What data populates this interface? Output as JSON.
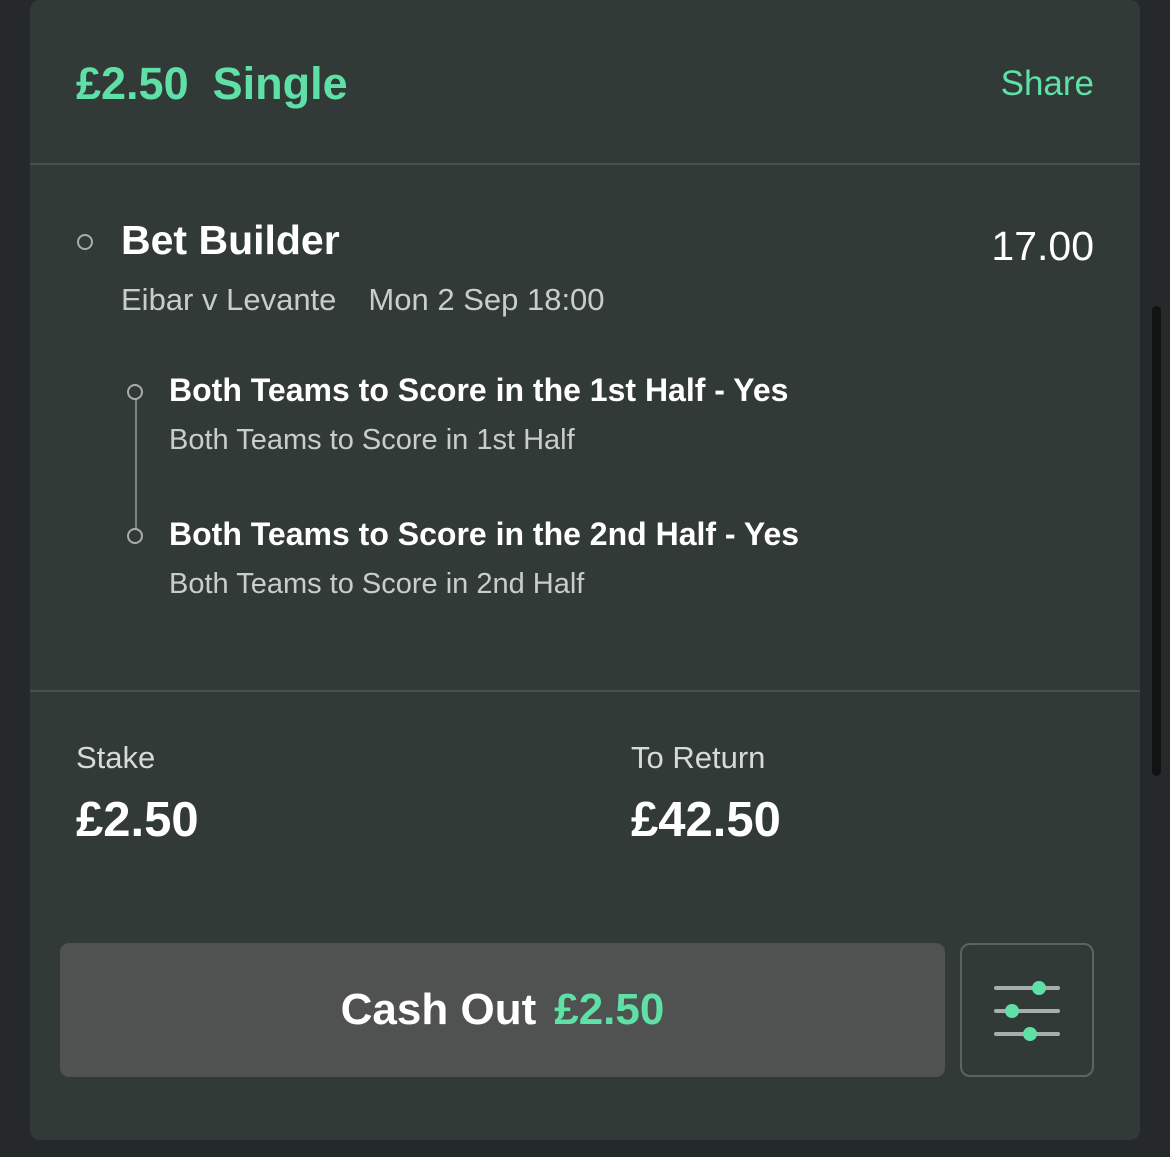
{
  "header": {
    "stake": "£2.50",
    "bet_type": "Single",
    "share_label": "Share"
  },
  "bet": {
    "name": "Bet Builder",
    "odds": "17.00",
    "event": "Eibar v Levante",
    "datetime": "Mon 2 Sep 18:00",
    "selections": [
      {
        "title": "Both Teams to Score in the 1st Half - Yes",
        "market": "Both Teams to Score in 1st Half"
      },
      {
        "title": "Both Teams to Score in the 2nd Half - Yes",
        "market": "Both Teams to Score in 2nd Half"
      }
    ]
  },
  "summary": {
    "stake_label": "Stake",
    "stake_value": "£2.50",
    "return_label": "To Return",
    "return_value": "£42.50"
  },
  "cashout": {
    "label": "Cash Out",
    "amount": "£2.50"
  },
  "icons": {
    "settings": "sliders-icon",
    "leg_marker": "ring-icon"
  },
  "colors": {
    "accent": "#5fe0a7",
    "card_bg": "#323a37",
    "page_bg": "#262929",
    "button_bg": "#4f5250"
  }
}
